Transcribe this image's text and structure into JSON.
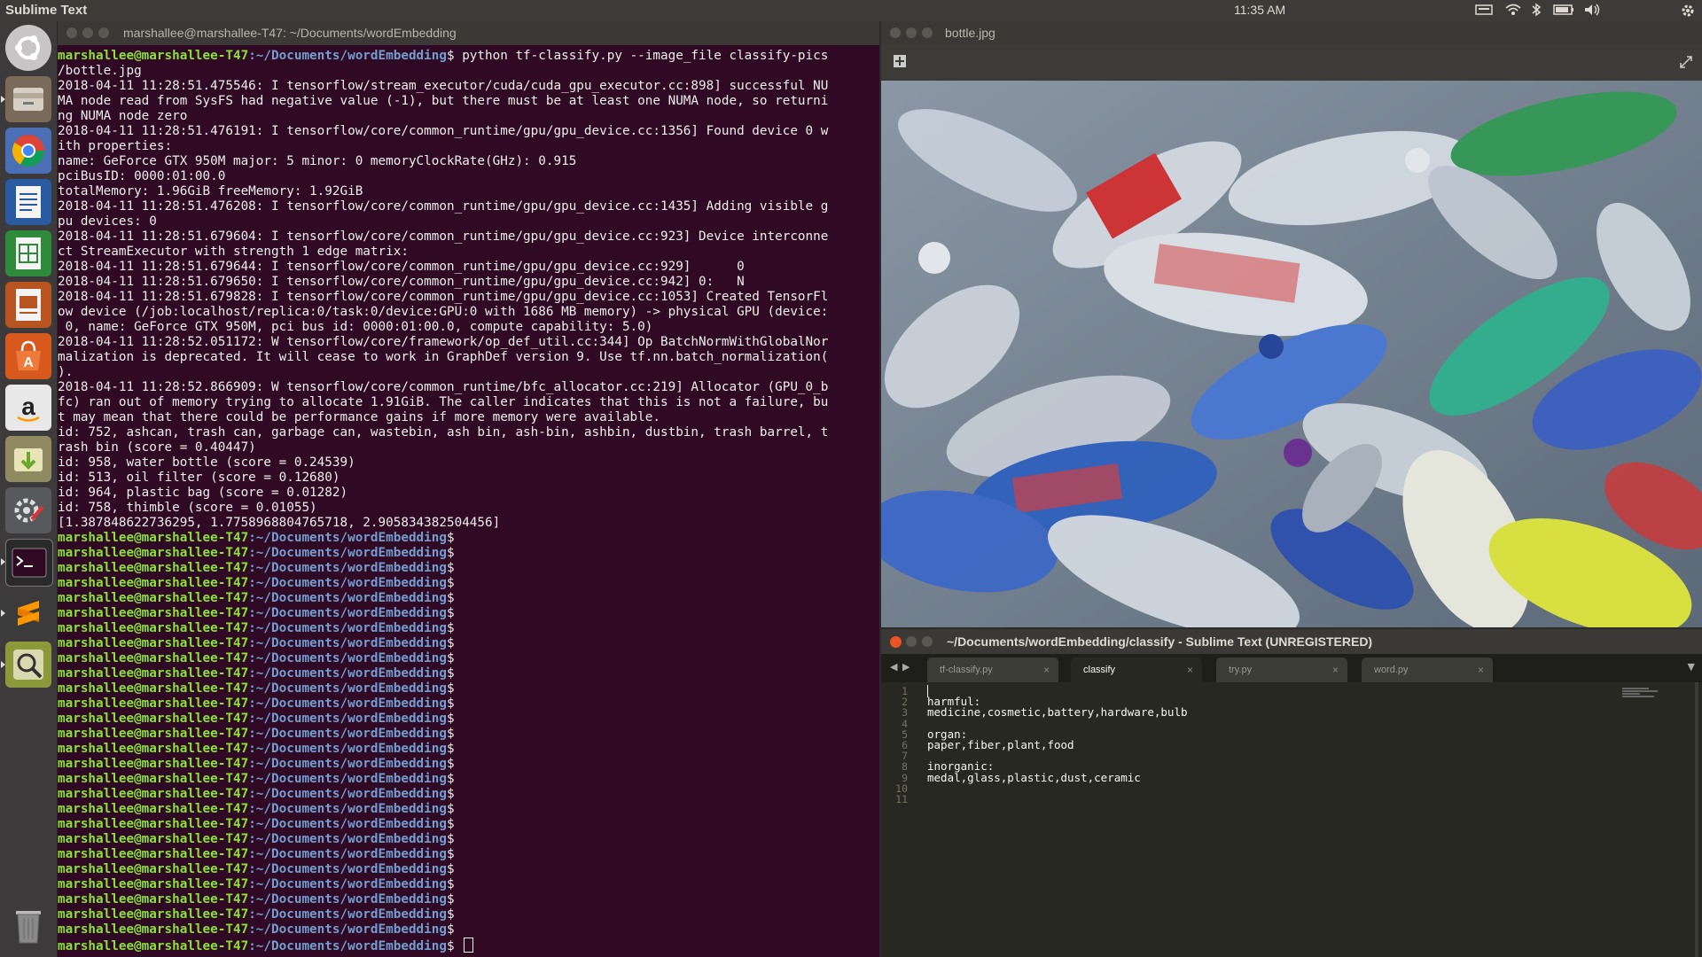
{
  "topbar": {
    "app_name": "Sublime Text",
    "time": "11:35 AM",
    "icons": [
      "keyboard-icon",
      "wifi-icon",
      "bluetooth-icon",
      "battery-icon",
      "volume-icon",
      "gear-icon"
    ]
  },
  "launcher": {
    "items": [
      "ubuntu-dash",
      "files",
      "chromium",
      "libreoffice-writer",
      "libreoffice-calc",
      "libreoffice-impress",
      "software-center",
      "amazon",
      "transmission",
      "system-settings",
      "terminal",
      "sublime-text",
      "image-viewer",
      "trash"
    ]
  },
  "terminal": {
    "title": "marshallee@marshallee-T47: ~/Documents/wordEmbedding",
    "prompt_user": "marshallee@marshallee-T47",
    "prompt_path": ":~/Documents/wordEmbedding",
    "prompt_symbol": "$",
    "command_line": " python tf-classify.py --image_file classify-pics",
    "output_lines": [
      "/bottle.jpg",
      "2018-04-11 11:28:51.475546: I tensorflow/stream_executor/cuda/cuda_gpu_executor.cc:898] successful NU",
      "MA node read from SysFS had negative value (-1), but there must be at least one NUMA node, so returni",
      "ng NUMA node zero",
      "2018-04-11 11:28:51.476191: I tensorflow/core/common_runtime/gpu/gpu_device.cc:1356] Found device 0 w",
      "ith properties:",
      "name: GeForce GTX 950M major: 5 minor: 0 memoryClockRate(GHz): 0.915",
      "pciBusID: 0000:01:00.0",
      "totalMemory: 1.96GiB freeMemory: 1.92GiB",
      "2018-04-11 11:28:51.476208: I tensorflow/core/common_runtime/gpu/gpu_device.cc:1435] Adding visible g",
      "pu devices: 0",
      "2018-04-11 11:28:51.679604: I tensorflow/core/common_runtime/gpu/gpu_device.cc:923] Device interconne",
      "ct StreamExecutor with strength 1 edge matrix:",
      "2018-04-11 11:28:51.679644: I tensorflow/core/common_runtime/gpu/gpu_device.cc:929]      0",
      "2018-04-11 11:28:51.679650: I tensorflow/core/common_runtime/gpu/gpu_device.cc:942] 0:   N",
      "2018-04-11 11:28:51.679828: I tensorflow/core/common_runtime/gpu/gpu_device.cc:1053] Created TensorFl",
      "ow device (/job:localhost/replica:0/task:0/device:GPU:0 with 1686 MB memory) -> physical GPU (device:",
      " 0, name: GeForce GTX 950M, pci bus id: 0000:01:00.0, compute capability: 5.0)",
      "2018-04-11 11:28:52.051172: W tensorflow/core/framework/op_def_util.cc:344] Op BatchNormWithGlobalNor",
      "malization is deprecated. It will cease to work in GraphDef version 9. Use tf.nn.batch_normalization(",
      ").",
      "2018-04-11 11:28:52.866909: W tensorflow/core/common_runtime/bfc_allocator.cc:219] Allocator (GPU_0_b",
      "fc) ran out of memory trying to allocate 1.91GiB. The caller indicates that this is not a failure, bu",
      "t may mean that there could be performance gains if more memory were available.",
      "id: 752, ashcan, trash can, garbage can, wastebin, ash bin, ash-bin, ashbin, dustbin, trash barrel, t",
      "rash bin (score = 0.40447)",
      "id: 958, water bottle (score = 0.24539)",
      "id: 513, oil filter (score = 0.12680)",
      "id: 964, plastic bag (score = 0.01282)",
      "id: 758, thimble (score = 0.01055)",
      "[1.387848622736295, 1.7758968804765718, 2.905834382504456]"
    ],
    "empty_prompt_count": 28
  },
  "viewer": {
    "title": "bottle.jpg"
  },
  "sublime": {
    "title": "~/Documents/wordEmbedding/classify - Sublime Text (UNREGISTERED)",
    "tabs": [
      {
        "label": "tf-classify.py",
        "active": false
      },
      {
        "label": "classify",
        "active": true
      },
      {
        "label": "try.py",
        "active": false
      },
      {
        "label": "word.py",
        "active": false
      }
    ],
    "lines": [
      {
        "n": "1",
        "text": ""
      },
      {
        "n": "2",
        "text": "harmful:"
      },
      {
        "n": "3",
        "text": "medicine,cosmetic,battery,hardware,bulb"
      },
      {
        "n": "4",
        "text": ""
      },
      {
        "n": "5",
        "text": "organ:"
      },
      {
        "n": "6",
        "text": "paper,fiber,plant,food"
      },
      {
        "n": "7",
        "text": ""
      },
      {
        "n": "8",
        "text": "inorganic:"
      },
      {
        "n": "9",
        "text": "medal,glass,plastic,dust,ceramic"
      },
      {
        "n": "10",
        "text": ""
      },
      {
        "n": "11",
        "text": ""
      }
    ]
  }
}
